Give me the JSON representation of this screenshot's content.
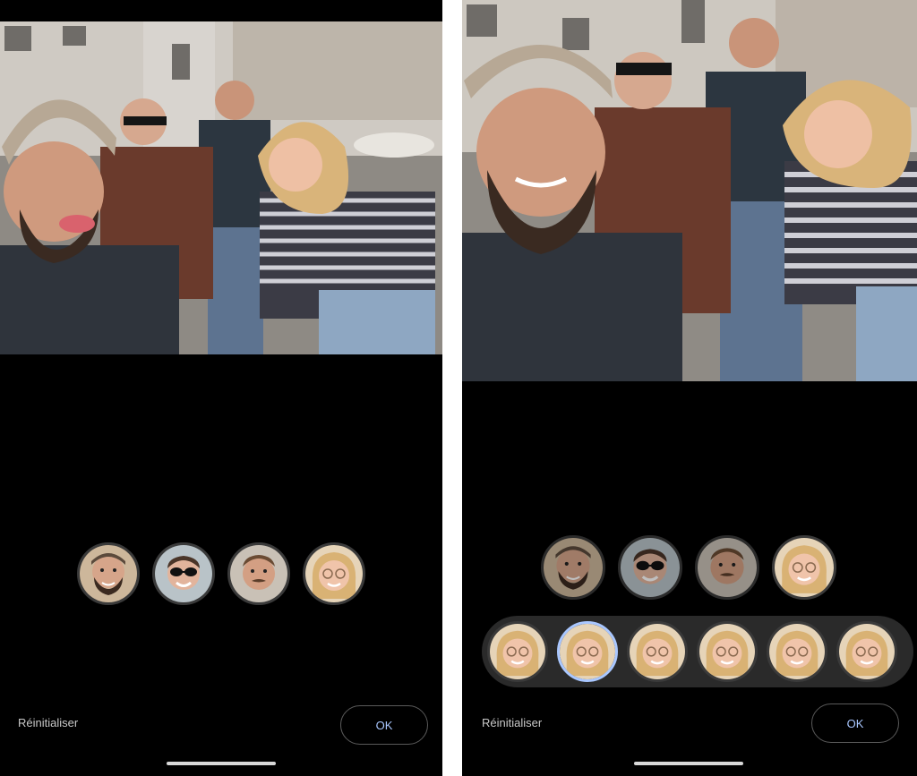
{
  "screens": [
    {
      "reset_label": "Réinitialiser",
      "ok_label": "OK"
    },
    {
      "reset_label": "Réinitialiser",
      "ok_label": "OK"
    }
  ],
  "face_icons": {
    "person_1": "bearded-man-cap-face",
    "person_2": "woman-sunglasses-face",
    "person_3": "man-mustache-face",
    "person_4": "blonde-woman-glasses-face"
  },
  "colors": {
    "background": "#000000",
    "accent": "#a9c7ff",
    "strip": "#2a2a2a"
  }
}
